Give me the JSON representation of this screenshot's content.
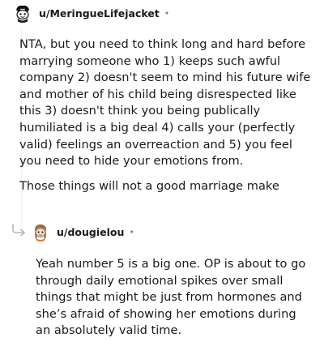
{
  "comments": [
    {
      "username": "u/MeringueLifejacket",
      "separator": "•",
      "paragraphs": [
        "NTA, but you need to think long and hard before marrying someone who 1) keeps such awful company 2) doesn't seem to mind his future wife and mother of his child being disrespected like this 3) doesn't think you being publically humiliated is a big deal 4) calls your (perfectly valid) feelings an overreaction and 5) you feel you need to hide your emotions from.",
        "Those things will not a good marriage make"
      ]
    },
    {
      "username": "u/dougielou",
      "separator": "•",
      "paragraphs": [
        "Yeah number 5 is a big one. OP is about to go through daily emotional spikes over small things that might be just from hormones and she’s afraid of showing her emotions during an absolutely valid time."
      ]
    }
  ]
}
